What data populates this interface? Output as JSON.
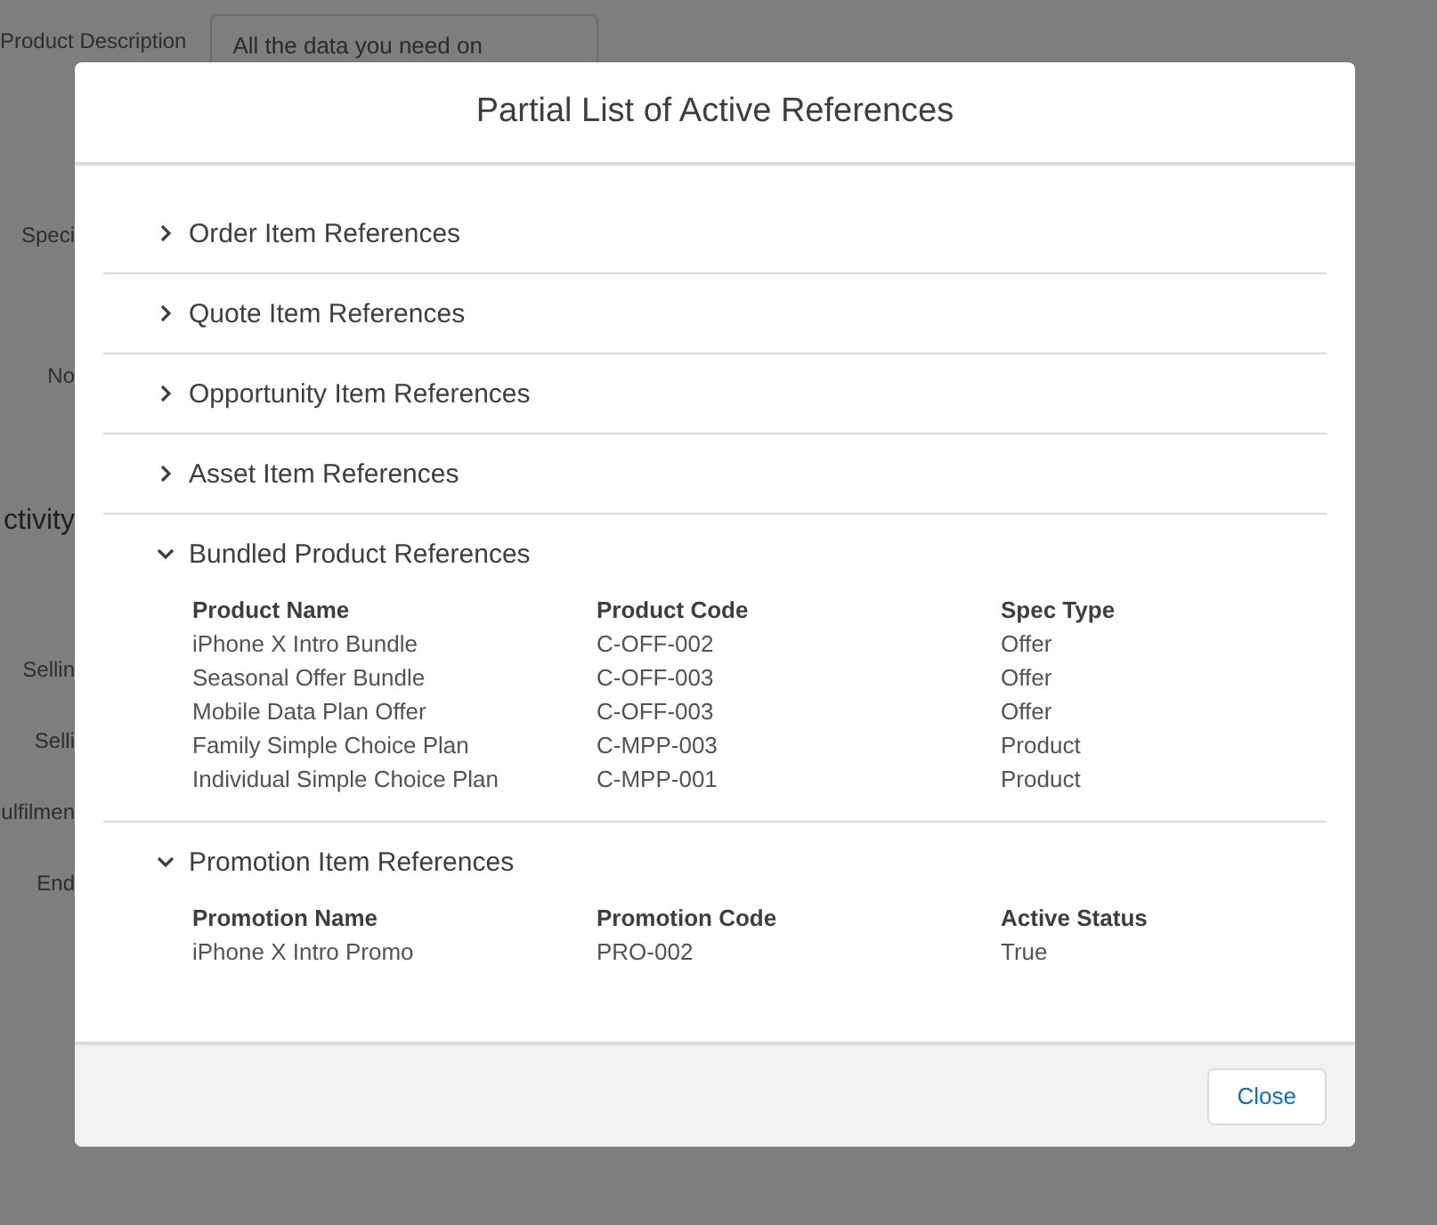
{
  "background_page": {
    "description_label": "Product Description",
    "description_value": "All the data you need on",
    "labels": [
      {
        "text": "Speci",
        "kind": "label"
      },
      {
        "text": "No",
        "kind": "label"
      },
      {
        "text": "ctivity",
        "kind": "heading"
      },
      {
        "text": "Sellin",
        "kind": "label"
      },
      {
        "text": "Selli",
        "kind": "label"
      },
      {
        "text": "ulfilmen",
        "kind": "label"
      },
      {
        "text": "End",
        "kind": "label"
      }
    ]
  },
  "modal": {
    "title": "Partial List of Active References",
    "sections": [
      {
        "title": "Order Item References",
        "expanded": false
      },
      {
        "title": "Quote Item References",
        "expanded": false
      },
      {
        "title": "Opportunity Item References",
        "expanded": false
      },
      {
        "title": "Asset Item References",
        "expanded": false
      },
      {
        "title": "Bundled Product References",
        "expanded": true,
        "columns": [
          "Product Name",
          "Product Code",
          "Spec Type"
        ],
        "rows": [
          [
            "iPhone X Intro Bundle",
            "C-OFF-002",
            "Offer"
          ],
          [
            "Seasonal Offer Bundle",
            "C-OFF-003",
            "Offer"
          ],
          [
            "Mobile Data Plan Offer",
            "C-OFF-003",
            "Offer"
          ],
          [
            "Family Simple Choice Plan",
            "C-MPP-003",
            "Product"
          ],
          [
            "Individual Simple Choice Plan",
            "C-MPP-001",
            "Product"
          ]
        ]
      },
      {
        "title": "Promotion Item References",
        "expanded": true,
        "columns": [
          "Promotion Name",
          "Promotion Code",
          "Active Status"
        ],
        "rows": [
          [
            "iPhone X Intro Promo",
            "PRO-002",
            "True"
          ]
        ]
      }
    ],
    "buttons": [
      "Close"
    ]
  }
}
